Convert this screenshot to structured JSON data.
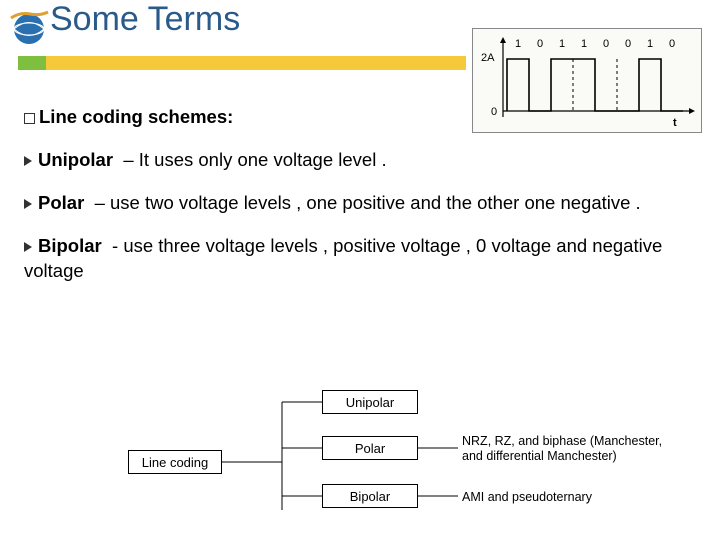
{
  "title": "Some Terms",
  "waveform": {
    "bits": [
      "1",
      "0",
      "1",
      "1",
      "0",
      "0",
      "1",
      "0"
    ],
    "y_top_label": "2A",
    "y_bot_label": "0",
    "x_label": "t"
  },
  "heading": "Line coding schemes:",
  "items": [
    {
      "term": "Unipolar",
      "sep": "–",
      "desc": "It uses only one voltage level ."
    },
    {
      "term": "Polar",
      "sep": "–",
      "desc": "use two voltage levels , one positive and the other one negative ."
    },
    {
      "term": "Bipolar",
      "sep": "-",
      "desc": "use three voltage levels , positive voltage , 0 voltage and negative voltage"
    }
  ],
  "diagram": {
    "root": "Line coding",
    "branches": [
      "Unipolar",
      "Polar",
      "Bipolar"
    ],
    "notes": {
      "polar": "NRZ, RZ, and biphase (Manchester, and differential Manchester)",
      "bipolar": "AMI and pseudoternary"
    }
  }
}
